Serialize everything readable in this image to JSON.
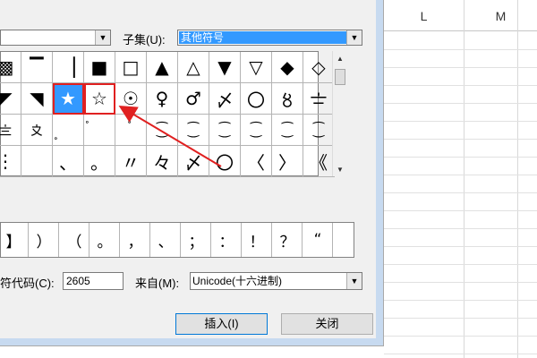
{
  "font_row": {
    "combo_value": ""
  },
  "subset": {
    "label": "子集(U):",
    "value": "其他符号"
  },
  "grid": {
    "rows": [
      [
        "▩",
        "▔",
        "▕",
        "■",
        "□",
        "▲",
        "△",
        "▼",
        "▽",
        "◆",
        "◇"
      ],
      [
        "◤",
        "◥",
        "★",
        "☆",
        "☉",
        "♀",
        "♂",
        "〆",
        "〇",
        "〥",
        "〧"
      ],
      [
        "〨",
        "〩",
        "〪",
        "〫",
        "〬",
        "⁐",
        "⁐",
        "⁐",
        "⁐",
        "⁐",
        "⁐"
      ],
      [
        "⋮",
        "",
        "、",
        "。",
        "〃",
        "々",
        "〆",
        "〇",
        "〈",
        "〉",
        "《"
      ]
    ]
  },
  "recent": [
    "】",
    "）",
    "（",
    "。",
    "，",
    "、",
    "；",
    "：",
    "！",
    "？",
    "“"
  ],
  "char_code": {
    "label": "符代码(C):",
    "value": "2605"
  },
  "from": {
    "label": "来自(M):",
    "value": "Unicode(十六进制)"
  },
  "buttons": {
    "insert": "插入(I)",
    "close": "关闭"
  },
  "sheet": {
    "columns": [
      "L",
      "M"
    ]
  },
  "colors": {
    "selected": "#3399ff",
    "highlight": "#e02020",
    "arrow": "#e02020"
  }
}
